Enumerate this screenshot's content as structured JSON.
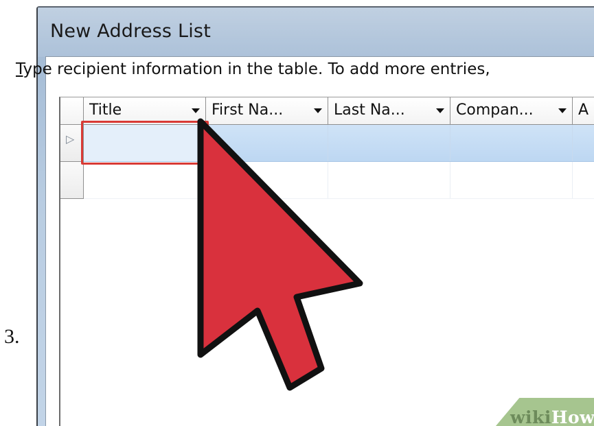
{
  "step_label": "3.",
  "dialog": {
    "title": "New Address List",
    "instructions_mnemonic": "T",
    "instructions_rest": "ype recipient information in the table.  To add more entries,"
  },
  "grid": {
    "columns": [
      {
        "label": "Title"
      },
      {
        "label": "First Na..."
      },
      {
        "label": "Last Na..."
      },
      {
        "label": "Compan..."
      },
      {
        "label": "A"
      }
    ],
    "row_pointer_glyph": "▷"
  },
  "annotation": {
    "highlight_color": "#d93a35",
    "arrow_color": "#d9313d",
    "arrow_outline_color": "#111111"
  },
  "watermark": {
    "part1": "wiki",
    "part2": "How"
  },
  "colors": {
    "selected_row": "#bdd7f2",
    "dialog_frame": "#b9cde2"
  }
}
